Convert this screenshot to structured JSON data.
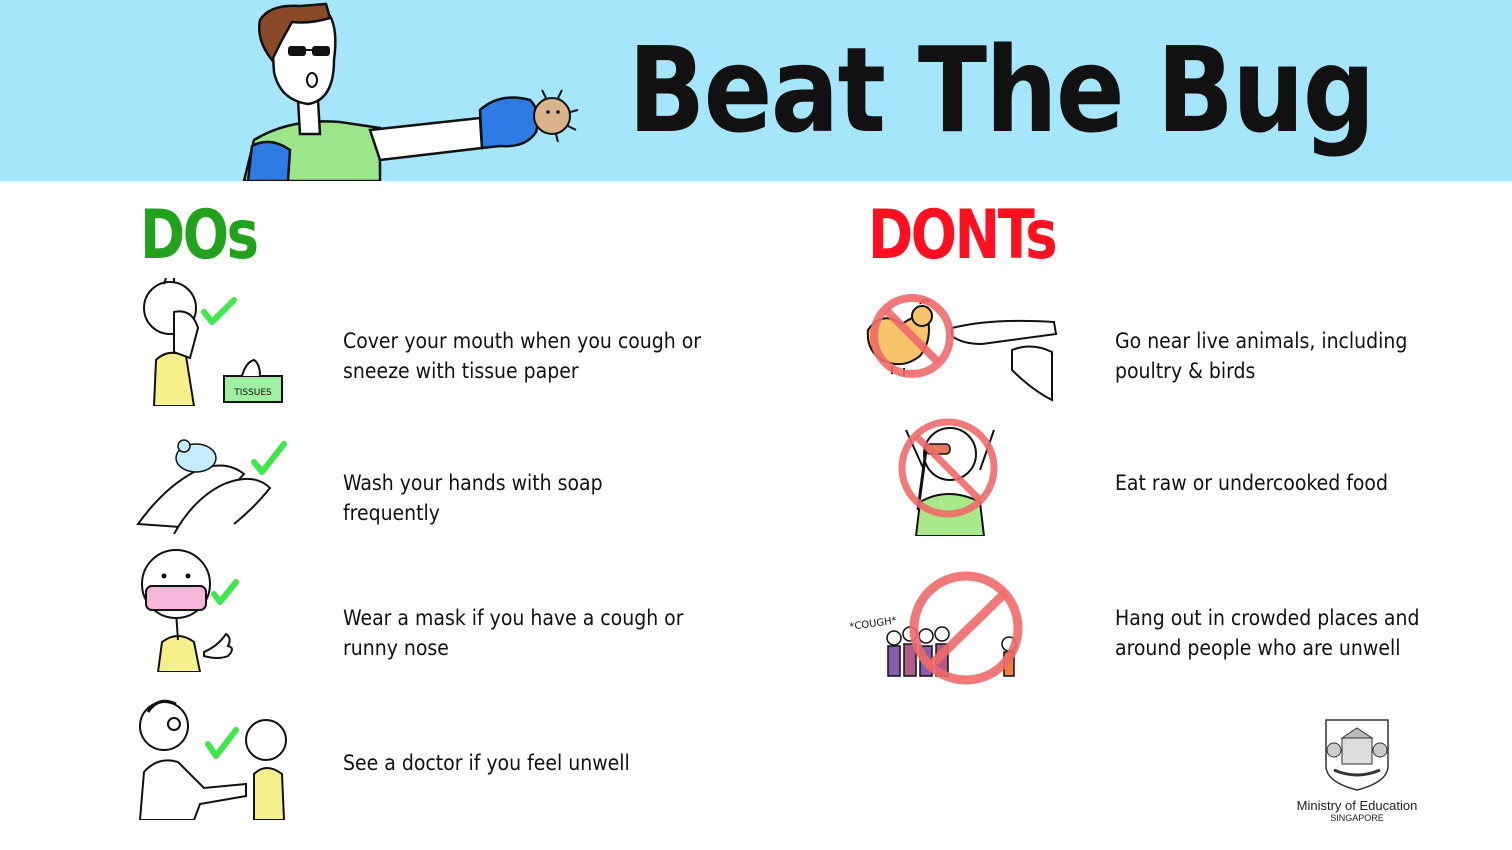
{
  "banner": {
    "title": "Beat The Bug"
  },
  "dos": {
    "heading": "DOs",
    "items": [
      {
        "text": "Cover your mouth when you cough or\nsneeze with tissue paper",
        "tissue_label": "TISSUES"
      },
      {
        "text": "Wash your hands with soap frequently"
      },
      {
        "text": "Wear a mask if you have a cough or\nrunny nose"
      },
      {
        "text": "See a doctor if you feel unwell"
      }
    ]
  },
  "donts": {
    "heading": "DONTs",
    "items": [
      {
        "text": "Go near live animals, including\npoultry & birds"
      },
      {
        "text": "Eat raw or undercooked food"
      },
      {
        "text": "Hang out in crowded places and\naround people who are unwell",
        "cough_label": "*COUGH*"
      }
    ]
  },
  "logo": {
    "name": "Ministry of Education",
    "country": "SINGAPORE"
  },
  "colors": {
    "banner": "#a5e6fd",
    "do_green": "#22a21c",
    "dont_red": "#ff0f1f",
    "check": "#3ee84a",
    "prohibit": "#f06a6a"
  }
}
